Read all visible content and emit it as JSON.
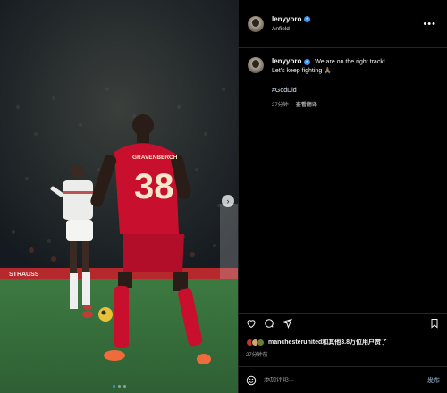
{
  "post": {
    "username": "lenyyoro",
    "location": "Anfield",
    "more_label": "•••",
    "caption_line1": "We are on the right track!",
    "caption_line2": "Let's keep fighting 🙏🏽",
    "hashtag": "#GodDid",
    "caption_time": "27分钟",
    "see_translation": "查看翻译",
    "likes_text": "manchesterunited和其他3.8万位用户赞了",
    "post_time": "27分钟前",
    "comment_placeholder": "添加评论...",
    "post_button": "发布"
  },
  "photo": {
    "shirt_name": "GRAVENBERCH",
    "shirt_number": "38",
    "board_text": "STRAUSS",
    "carousel_next": "›",
    "carousel_total": 3,
    "carousel_active": 1
  },
  "colors": {
    "verified": "#3897f0",
    "liverpool_red": "#c8102e",
    "pitch_green": "#3f7a43",
    "panel_bg": "#000000"
  },
  "icons": [
    "heart-icon",
    "comment-icon",
    "share-icon",
    "bookmark-icon",
    "emoji-icon",
    "more-icon",
    "verified-icon",
    "chevron-right-icon"
  ]
}
